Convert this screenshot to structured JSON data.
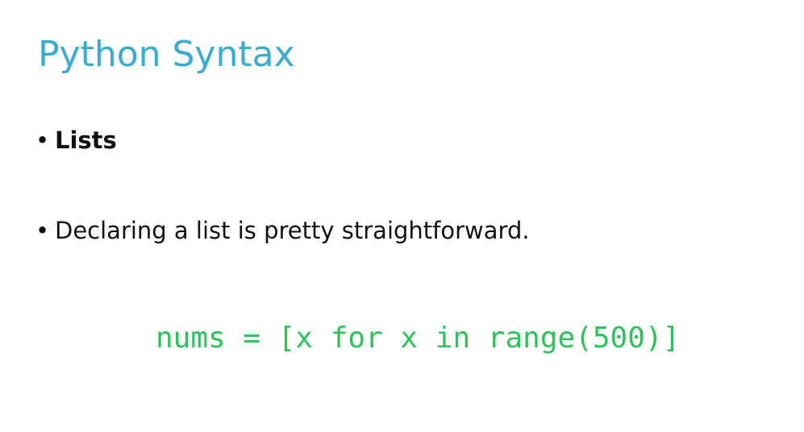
{
  "slide": {
    "title": "Python Syntax",
    "bullets": [
      {
        "marker": "•",
        "text": "Lists"
      },
      {
        "marker": "•",
        "text": "Declaring a list is pretty straightforward."
      }
    ],
    "code": "nums = [x for x in range(500)]"
  },
  "colors": {
    "title": "#39acd1",
    "code": "#2fc25b",
    "text": "#111111"
  }
}
